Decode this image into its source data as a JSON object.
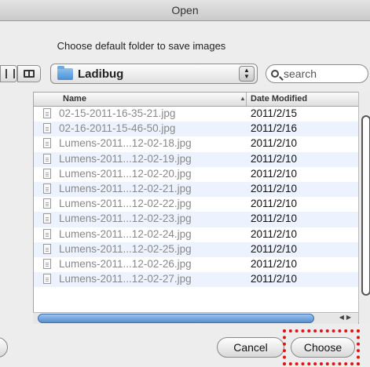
{
  "dialog": {
    "title": "Open",
    "prompt": "Choose default folder to save images"
  },
  "toolbar": {
    "folder": "Ladibug",
    "search_placeholder": "search"
  },
  "table": {
    "columns": [
      "Name",
      "Date Modified"
    ],
    "rows": [
      {
        "name": "02-15-2011-16-35-21.jpg",
        "date": "2011/2/15"
      },
      {
        "name": "02-16-2011-15-46-50.jpg",
        "date": "2011/2/16"
      },
      {
        "name": "Lumens-2011...12-02-18.jpg",
        "date": "2011/2/10"
      },
      {
        "name": "Lumens-2011...12-02-19.jpg",
        "date": "2011/2/10"
      },
      {
        "name": "Lumens-2011...12-02-20.jpg",
        "date": "2011/2/10"
      },
      {
        "name": "Lumens-2011...12-02-21.jpg",
        "date": "2011/2/10"
      },
      {
        "name": "Lumens-2011...12-02-22.jpg",
        "date": "2011/2/10"
      },
      {
        "name": "Lumens-2011...12-02-23.jpg",
        "date": "2011/2/10"
      },
      {
        "name": "Lumens-2011...12-02-24.jpg",
        "date": "2011/2/10"
      },
      {
        "name": "Lumens-2011...12-02-25.jpg",
        "date": "2011/2/10"
      },
      {
        "name": "Lumens-2011...12-02-26.jpg",
        "date": "2011/2/10"
      },
      {
        "name": "Lumens-2011...12-02-27.jpg",
        "date": "2011/2/10"
      }
    ]
  },
  "buttons": {
    "cancel": "Cancel",
    "choose": "Choose"
  },
  "colors": {
    "highlight": "#e01414",
    "alt_row": "#edf3fe"
  }
}
